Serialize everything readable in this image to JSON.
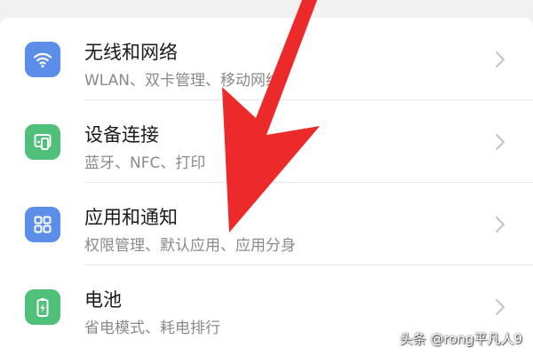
{
  "settings": {
    "items": [
      {
        "title": "无线和网络",
        "subtitle": "WLAN、双卡管理、移动网络",
        "icon": "wifi-icon",
        "icon_color": "#5b8ee8"
      },
      {
        "title": "设备连接",
        "subtitle": "蓝牙、NFC、打印",
        "icon": "device-connection-icon",
        "icon_color": "#4fbf79"
      },
      {
        "title": "应用和通知",
        "subtitle": "权限管理、默认应用、应用分身",
        "icon": "apps-grid-icon",
        "icon_color": "#5b8ee8"
      },
      {
        "title": "电池",
        "subtitle": "省电模式、耗电排行",
        "icon": "battery-icon",
        "icon_color": "#4fbf79"
      }
    ]
  },
  "overlay": {
    "arrow_color": "#ec2a2a"
  },
  "watermark": {
    "text": "头条 @rong平凡人9"
  }
}
